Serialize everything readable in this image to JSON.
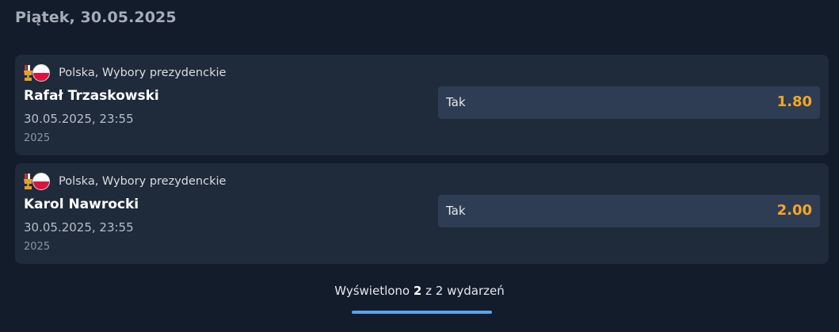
{
  "date_header": "Piątek, 30.05.2025",
  "events": [
    {
      "league": "Polska, Wybory prezydenckie",
      "name": "Rafał Trzaskowski",
      "datetime": "30.05.2025, 23:55",
      "year": "2025",
      "odds": {
        "label": "Tak",
        "value": "1.80"
      }
    },
    {
      "league": "Polska, Wybory prezydenckie",
      "name": "Karol Nawrocki",
      "datetime": "30.05.2025, 23:55",
      "year": "2025",
      "odds": {
        "label": "Tak",
        "value": "2.00"
      }
    }
  ],
  "footer": {
    "prefix": "Wyświetlono",
    "shown": "2",
    "middle": "z",
    "total": "2",
    "suffix": "wydarzeń"
  },
  "progress": {
    "fraction": 1.0
  },
  "colors": {
    "background": "#131c2b",
    "card": "#1f2a3a",
    "odds_button": "#2f3d54",
    "odds_value": "#f5a623",
    "progress": "#5aa2f0"
  },
  "icons": {
    "trophy": "trophy-icon",
    "flag": "poland-flag-icon"
  }
}
